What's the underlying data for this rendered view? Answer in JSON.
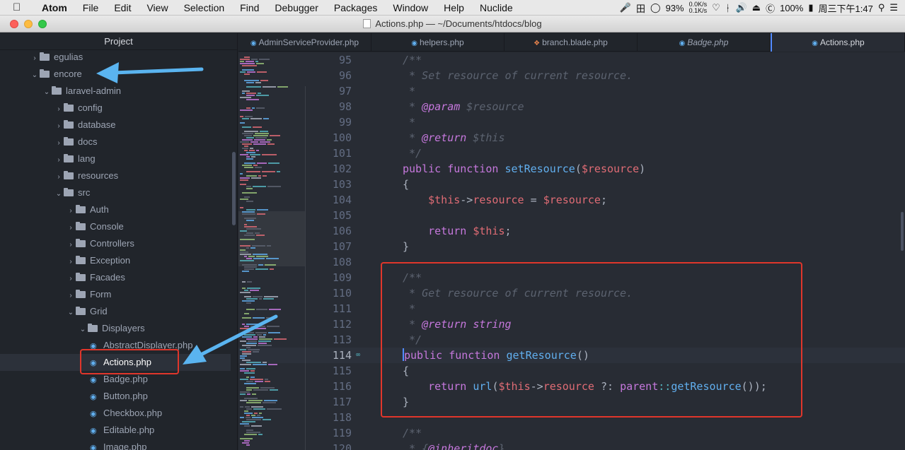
{
  "menubar": {
    "items": [
      "Atom",
      "File",
      "Edit",
      "View",
      "Selection",
      "Find",
      "Debugger",
      "Packages",
      "Window",
      "Help",
      "Nuclide"
    ],
    "status": {
      "cpu_percent": "93%",
      "net_up": "0.0K/s",
      "net_down": "0.1K/s",
      "battery": "100%",
      "clock": "周三下午1:47"
    }
  },
  "window": {
    "title": "Actions.php — ~/Documents/htdocs/blog"
  },
  "tree": {
    "header": "Project",
    "rows": [
      {
        "label": "egulias",
        "type": "folder",
        "expanded": false,
        "depth": 0
      },
      {
        "label": "encore",
        "type": "folder",
        "expanded": true,
        "depth": 0
      },
      {
        "label": "laravel-admin",
        "type": "folder",
        "expanded": true,
        "depth": 1
      },
      {
        "label": "config",
        "type": "folder",
        "expanded": false,
        "depth": 2
      },
      {
        "label": "database",
        "type": "folder",
        "expanded": false,
        "depth": 2
      },
      {
        "label": "docs",
        "type": "folder",
        "expanded": false,
        "depth": 2
      },
      {
        "label": "lang",
        "type": "folder",
        "expanded": false,
        "depth": 2
      },
      {
        "label": "resources",
        "type": "folder",
        "expanded": false,
        "depth": 2
      },
      {
        "label": "src",
        "type": "folder",
        "expanded": true,
        "depth": 2
      },
      {
        "label": "Auth",
        "type": "folder",
        "expanded": false,
        "depth": 3
      },
      {
        "label": "Console",
        "type": "folder",
        "expanded": false,
        "depth": 3
      },
      {
        "label": "Controllers",
        "type": "folder",
        "expanded": false,
        "depth": 3
      },
      {
        "label": "Exception",
        "type": "folder",
        "expanded": false,
        "depth": 3
      },
      {
        "label": "Facades",
        "type": "folder",
        "expanded": false,
        "depth": 3
      },
      {
        "label": "Form",
        "type": "folder",
        "expanded": false,
        "depth": 3
      },
      {
        "label": "Grid",
        "type": "folder",
        "expanded": true,
        "depth": 3
      },
      {
        "label": "Displayers",
        "type": "folder",
        "expanded": true,
        "depth": 4
      },
      {
        "label": "AbstractDisplayer.php",
        "type": "file",
        "depth": 5
      },
      {
        "label": "Actions.php",
        "type": "file",
        "depth": 5,
        "selected": true
      },
      {
        "label": "Badge.php",
        "type": "file",
        "depth": 5
      },
      {
        "label": "Button.php",
        "type": "file",
        "depth": 5
      },
      {
        "label": "Checkbox.php",
        "type": "file",
        "depth": 5
      },
      {
        "label": "Editable.php",
        "type": "file",
        "depth": 5
      },
      {
        "label": "Image.php",
        "type": "file",
        "depth": 5
      }
    ]
  },
  "tabs": [
    {
      "label": "AdminServiceProvider.php",
      "icon": "php-elephant-icon"
    },
    {
      "label": "helpers.php",
      "icon": "php-elephant-icon"
    },
    {
      "label": "branch.blade.php",
      "icon": "blade-icon"
    },
    {
      "label": "Badge.php",
      "icon": "php-elephant-icon",
      "italic": true
    },
    {
      "label": "Actions.php",
      "icon": "php-elephant-icon",
      "active": true
    }
  ],
  "editor": {
    "cursor_line": 114,
    "lines": [
      {
        "n": "95"
      },
      {
        "n": "96"
      },
      {
        "n": "97"
      },
      {
        "n": "98"
      },
      {
        "n": "99"
      },
      {
        "n": "100"
      },
      {
        "n": "101"
      },
      {
        "n": "102"
      },
      {
        "n": "103"
      },
      {
        "n": "104"
      },
      {
        "n": "105"
      },
      {
        "n": "106"
      },
      {
        "n": "107"
      },
      {
        "n": "108"
      },
      {
        "n": "109"
      },
      {
        "n": "110"
      },
      {
        "n": "111"
      },
      {
        "n": "112"
      },
      {
        "n": "113"
      },
      {
        "n": "114"
      },
      {
        "n": "115"
      },
      {
        "n": "116"
      },
      {
        "n": "117"
      },
      {
        "n": "118"
      },
      {
        "n": "119"
      },
      {
        "n": "120"
      }
    ],
    "code": {
      "l95": "/**",
      "l96": " * Set resource of current resource.",
      "l97": " *",
      "l98_star": " * ",
      "l98_tag": "@param",
      "l98_rest": " $resource",
      "l99": " *",
      "l100_star": " * ",
      "l100_tag": "@return",
      "l100_rest": " $this",
      "l101": " */",
      "l102_kw1": "public",
      "l102_kw2": "function",
      "l102_fn": "setResource",
      "l102_p1": "(",
      "l102_var": "$resource",
      "l102_p2": ")",
      "l103": "{",
      "l104_this": "$this",
      "l104_arrow": "->",
      "l104_prop": "resource",
      "l104_eq": " = ",
      "l104_var": "$resource",
      "l104_end": ";",
      "l106_kw": "return",
      "l106_this": "$this",
      "l106_end": ";",
      "l107": "}",
      "l109": "/**",
      "l110": " * Get resource of current resource.",
      "l111": " *",
      "l112_star": " * ",
      "l112_tag": "@return",
      "l112_type": " string",
      "l113": " */",
      "l114_kw1": "public",
      "l114_kw2": "function",
      "l114_fn": "getResource",
      "l114_p": "()",
      "l115": "{",
      "l116_kw": "return",
      "l116_fn1": "url",
      "l116_p1": "(",
      "l116_this": "$this",
      "l116_arrow": "->",
      "l116_prop": "resource",
      "l116_op": " ?: ",
      "l116_parent": "parent",
      "l116_dc": "::",
      "l116_fn2": "getResource",
      "l116_end": "());",
      "l117": "}",
      "l119": "/**",
      "l120_star": " * {",
      "l120_tag": "@inheritdoc",
      "l120_end": "}"
    }
  },
  "colors": {
    "highlight_box": "#e0362b",
    "annotation_arrow": "#5ab4f0"
  }
}
